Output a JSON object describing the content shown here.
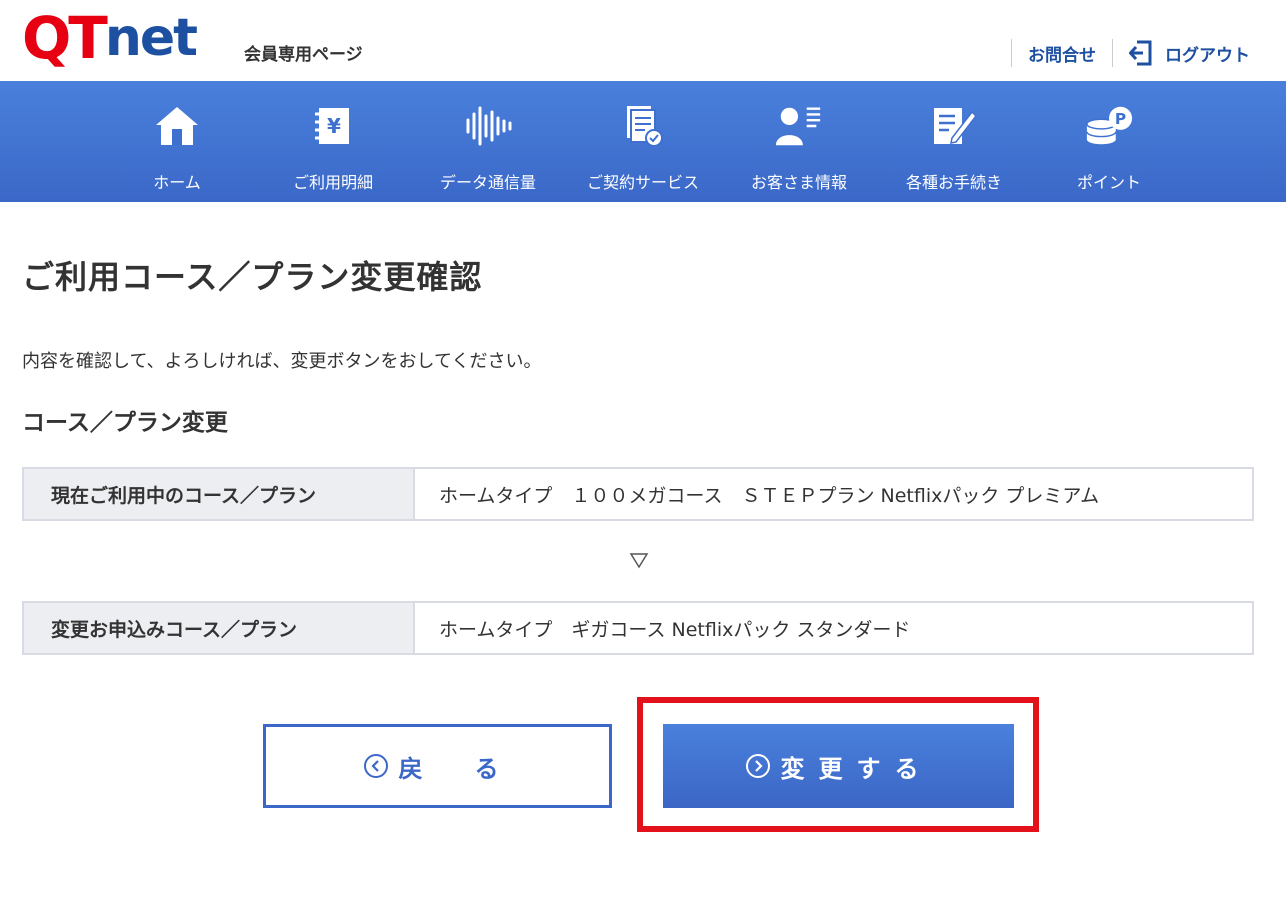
{
  "header": {
    "logo": "QTnet",
    "member_label": "会員専用ページ",
    "contact_label": "お問合せ",
    "logout_label": "ログアウト"
  },
  "nav": {
    "items": [
      {
        "label": "ホーム",
        "icon": "home-icon"
      },
      {
        "label": "ご利用明細",
        "icon": "billing-yen-icon"
      },
      {
        "label": "データ通信量",
        "icon": "data-usage-icon"
      },
      {
        "label": "ご契約サービス",
        "icon": "contract-doc-icon"
      },
      {
        "label": "お客さま情報",
        "icon": "customer-info-icon"
      },
      {
        "label": "各種お手続き",
        "icon": "procedure-pen-icon"
      },
      {
        "label": "ポイント",
        "icon": "point-coins-icon"
      }
    ]
  },
  "main": {
    "page_title": "ご利用コース／プラン変更確認",
    "intro": "内容を確認して、よろしければ、変更ボタンをおしてください。",
    "section_title": "コース／プラン変更",
    "current": {
      "label": "現在ご利用中のコース／プラン",
      "value": "ホームタイプ　１００メガコース　ＳＴＥＰプラン Netflixパック プレミアム"
    },
    "new": {
      "label": "変更お申込みコース／プラン",
      "value": "ホームタイプ　ギガコース Netflixパック スタンダード"
    }
  },
  "buttons": {
    "back": "戻　る",
    "change": "変更する"
  },
  "colors": {
    "brand_red": "#e60012",
    "brand_blue": "#1e50a2",
    "nav_blue": "#3b68c8",
    "highlight": "#e3121a"
  }
}
